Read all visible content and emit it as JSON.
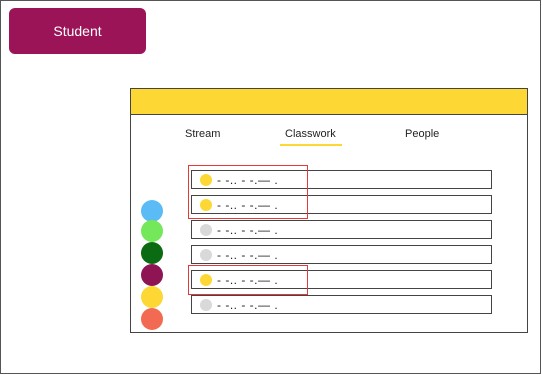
{
  "badge": {
    "label": "Student",
    "color": "#9b1458"
  },
  "card": {
    "header_color": "#fdd835"
  },
  "tabs": [
    {
      "label": "Stream"
    },
    {
      "label": "Classwork",
      "active": true
    },
    {
      "label": "People"
    }
  ],
  "rows": [
    {
      "text": "- -.. - -.— .",
      "status_color": "#fdd835"
    },
    {
      "text": "- -.. - -.— .",
      "status_color": "#fdd835"
    },
    {
      "text": "- -.. - -.— .",
      "status_color": "#d9d9d9"
    },
    {
      "text": "- -.. - -.— .",
      "status_color": "#d9d9d9"
    },
    {
      "text": "- -.. - -.— .",
      "status_color": "#fdd835"
    },
    {
      "text": "- -.. - -.— .",
      "status_color": "#d9d9d9"
    }
  ],
  "palette": [
    "#5bbcf5",
    "#74e85a",
    "#0b6b12",
    "#8e1454",
    "#fdd835",
    "#f36a52"
  ],
  "highlight_color": "#e53935"
}
